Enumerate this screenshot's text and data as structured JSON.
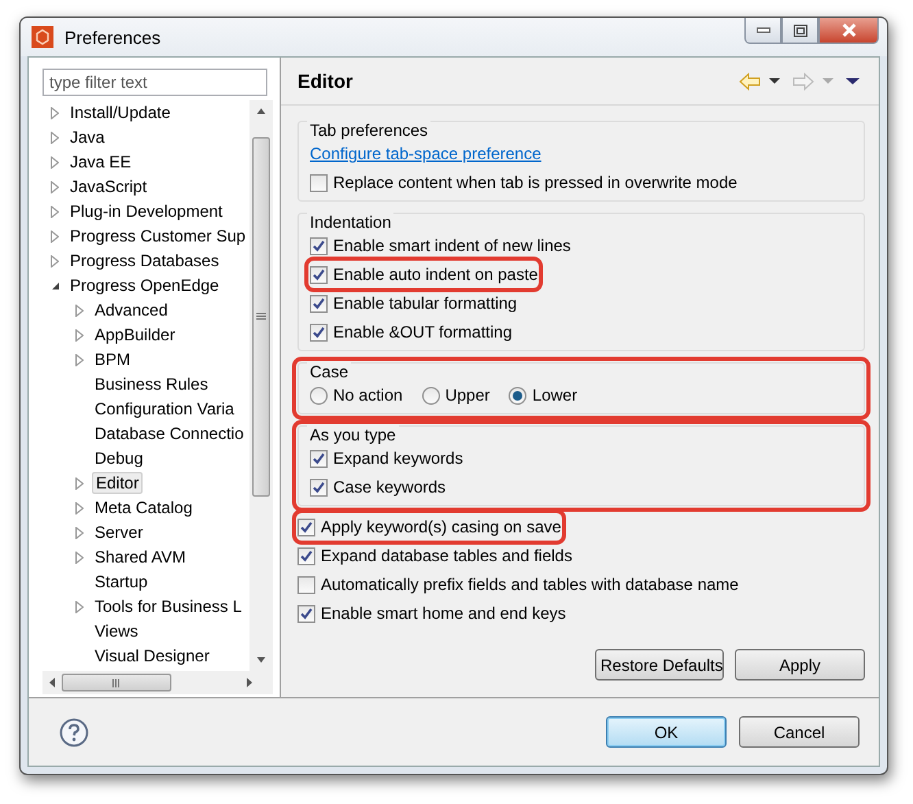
{
  "window": {
    "title": "Preferences"
  },
  "filter": {
    "placeholder": "type filter text"
  },
  "tree": [
    {
      "label": "Install/Update",
      "expandable": true,
      "expanded": false,
      "selected": false
    },
    {
      "label": "Java",
      "expandable": true,
      "expanded": false,
      "selected": false
    },
    {
      "label": "Java EE",
      "expandable": true,
      "expanded": false,
      "selected": false
    },
    {
      "label": "JavaScript",
      "expandable": true,
      "expanded": false,
      "selected": false
    },
    {
      "label": "Plug-in Development",
      "expandable": true,
      "expanded": false,
      "selected": false
    },
    {
      "label": "Progress Customer Sup",
      "expandable": true,
      "expanded": false,
      "selected": false
    },
    {
      "label": "Progress Databases",
      "expandable": true,
      "expanded": false,
      "selected": false
    },
    {
      "label": "Progress OpenEdge",
      "expandable": true,
      "expanded": true,
      "selected": false,
      "children": [
        {
          "label": "Advanced",
          "expandable": true,
          "expanded": false,
          "selected": false
        },
        {
          "label": "AppBuilder",
          "expandable": true,
          "expanded": false,
          "selected": false
        },
        {
          "label": "BPM",
          "expandable": true,
          "expanded": false,
          "selected": false
        },
        {
          "label": "Business Rules",
          "selected": false
        },
        {
          "label": "Configuration Varia",
          "selected": false
        },
        {
          "label": "Database Connectio",
          "selected": false
        },
        {
          "label": "Debug",
          "selected": false
        },
        {
          "label": "Editor",
          "expandable": true,
          "expanded": false,
          "selected": true
        },
        {
          "label": "Meta Catalog",
          "expandable": true,
          "expanded": false,
          "selected": false
        },
        {
          "label": "Server",
          "expandable": true,
          "expanded": false,
          "selected": false
        },
        {
          "label": "Shared AVM",
          "expandable": true,
          "expanded": false,
          "selected": false
        },
        {
          "label": "Startup",
          "selected": false
        },
        {
          "label": "Tools for Business L",
          "expandable": true,
          "expanded": false,
          "selected": false
        },
        {
          "label": "Views",
          "selected": false
        },
        {
          "label": "Visual Designer",
          "selected": false
        }
      ]
    }
  ],
  "page": {
    "title": "Editor",
    "groups": [
      {
        "title": "Tab preferences",
        "highlighted": false,
        "items": [
          {
            "kind": "link",
            "label": "Configure tab-space preference"
          },
          {
            "kind": "checkbox",
            "label": "Replace content when tab is pressed in overwrite mode",
            "checked": false,
            "highlighted": false
          }
        ]
      },
      {
        "title": "Indentation",
        "highlighted": false,
        "items": [
          {
            "kind": "checkbox",
            "label": "Enable smart indent of new lines",
            "checked": true,
            "highlighted": false
          },
          {
            "kind": "checkbox",
            "label": "Enable auto indent on paste",
            "checked": true,
            "highlighted": true
          },
          {
            "kind": "checkbox",
            "label": "Enable tabular formatting",
            "checked": true,
            "highlighted": false
          },
          {
            "kind": "checkbox",
            "label": "Enable &OUT formatting",
            "checked": true,
            "highlighted": false
          }
        ]
      },
      {
        "title": "Case",
        "highlighted": true,
        "items": [
          {
            "kind": "radio",
            "label": "No action",
            "selected": false
          },
          {
            "kind": "radio",
            "label": "Upper",
            "selected": false
          },
          {
            "kind": "radio",
            "label": "Lower",
            "selected": true
          }
        ]
      },
      {
        "title": "As you type",
        "highlighted": true,
        "items": [
          {
            "kind": "checkbox",
            "label": "Expand keywords",
            "checked": true,
            "highlighted": false
          },
          {
            "kind": "checkbox",
            "label": "Case keywords",
            "checked": true,
            "highlighted": false
          }
        ]
      }
    ],
    "options": [
      {
        "label": "Apply keyword(s) casing on save",
        "checked": true,
        "highlighted": true
      },
      {
        "label": "Expand database tables and fields",
        "checked": true,
        "highlighted": false
      },
      {
        "label": "Automatically prefix fields and tables with database name",
        "checked": false,
        "highlighted": false
      },
      {
        "label": "Enable smart home and end keys",
        "checked": true,
        "highlighted": false
      }
    ],
    "buttons": [
      "Restore Defaults",
      "Apply"
    ]
  },
  "dialog_buttons": [
    {
      "label": "OK",
      "default": true
    },
    {
      "label": "Cancel",
      "default": false
    }
  ]
}
